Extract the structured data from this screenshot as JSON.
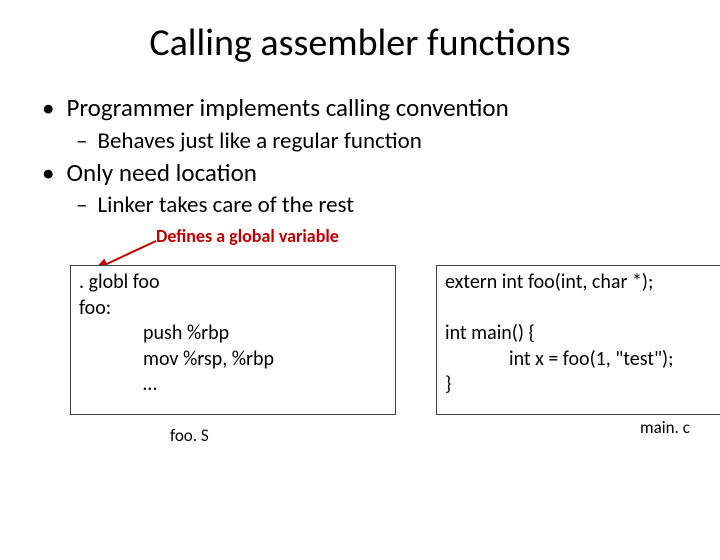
{
  "title": "Calling assembler functions",
  "bullets": [
    {
      "level": 1,
      "text": "Programmer implements calling convention"
    },
    {
      "level": 2,
      "text": "Behaves just like a regular function"
    },
    {
      "level": 1,
      "text": "Only need location"
    },
    {
      "level": 2,
      "text": "Linker takes care of the rest"
    }
  ],
  "annotation": "Defines a global variable",
  "left_code": {
    "l1": ". globl foo",
    "l2": "foo:",
    "l3": "push %rbp",
    "l4": "mov %rsp, %rbp",
    "l5": "…",
    "file": "foo. S"
  },
  "right_code": {
    "l1": "extern int foo(int, char *);",
    "l2": "",
    "l3": "int main() {",
    "l4": "int x = foo(1, \"test\");",
    "l5": "}",
    "file": "main. c"
  }
}
